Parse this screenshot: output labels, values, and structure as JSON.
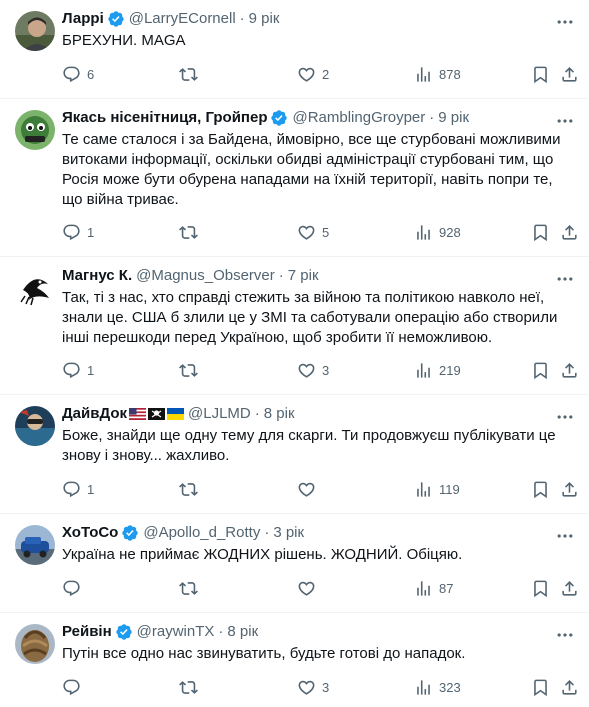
{
  "tweets": [
    {
      "name": "Ларрі",
      "verified": true,
      "handle": "@LarryECornell",
      "time": "9 рік",
      "text": "БРЕХУНИ. MAGA",
      "replies": "6",
      "retweets": "",
      "likes": "2",
      "views": "878"
    },
    {
      "name": "Якась нісенітниця, Гройпер",
      "verified": true,
      "handle": "@RamblingGroyper",
      "time": "9 рік",
      "text": "Те саме сталося і за Байдена, ймовірно, все ще стурбовані можливими витоками інформації, оскільки обидві адміністрації стурбовані тим, що Росія може бути обурена нападами на їхній території, навіть попри те, що війна триває.",
      "replies": "1",
      "retweets": "",
      "likes": "5",
      "views": "928"
    },
    {
      "name": "Магнус К.",
      "verified": false,
      "handle": "@Magnus_Observer",
      "time": "7 рік",
      "text": "Так, ті з нас, хто справді стежить за війною та політикою навколо неї, знали це. США б злили це у ЗМІ та саботували операцію або створили інші перешкоди перед Україною, щоб зробити її неможливою.",
      "replies": "1",
      "retweets": "",
      "likes": "3",
      "views": "219"
    },
    {
      "name": "ДайвДок",
      "verified": false,
      "handle": "@LJLMD",
      "time": "8 рік",
      "text": "Боже, знайди ще одну тему для скарги. Ти продовжуєш публікувати це знову і знову... жахливо.",
      "replies": "1",
      "retweets": "",
      "likes": "",
      "views": "119"
    },
    {
      "name": "ХоТоСо",
      "verified": true,
      "handle": "@Apollo_d_Rotty",
      "time": "3 рік",
      "text": "Україна не приймає ЖОДНИХ рішень. ЖОДНИЙ. Обіцяю.",
      "replies": "",
      "retweets": "",
      "likes": "",
      "views": "87"
    },
    {
      "name": "Рейвін",
      "verified": true,
      "handle": "@raywinTX",
      "time": "8 рік",
      "text": "Путін все одно нас звинуватить, будьте готові до нападок.",
      "replies": "",
      "retweets": "",
      "likes": "3",
      "views": "323"
    }
  ],
  "colors": {
    "text": "#0f1419",
    "secondary": "#536471",
    "verified": "#1d9bf0",
    "divider": "#eff3f4"
  }
}
